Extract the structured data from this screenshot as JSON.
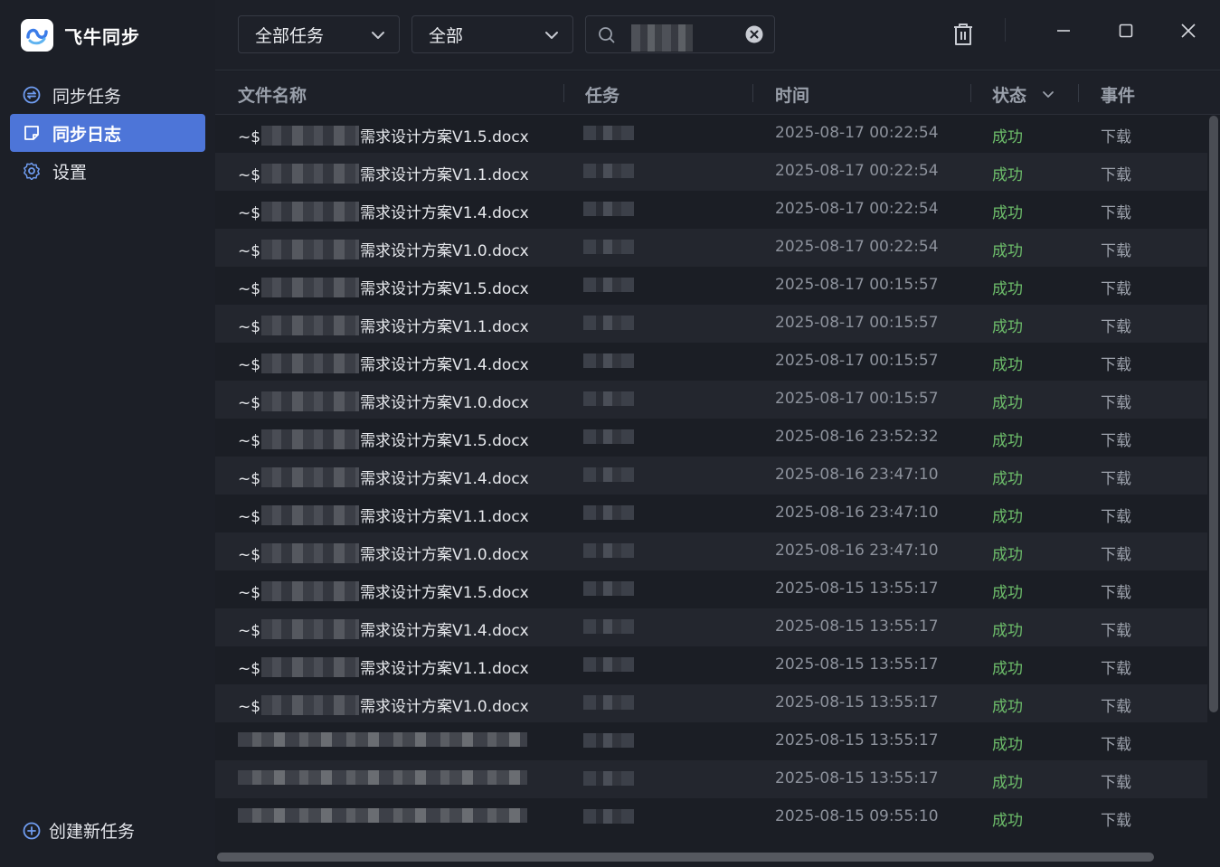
{
  "app": {
    "name": "飞牛同步"
  },
  "sidebar": {
    "items": [
      {
        "label": "同步任务",
        "icon": "sync-icon",
        "active": false
      },
      {
        "label": "同步日志",
        "icon": "log-icon",
        "active": true
      },
      {
        "label": "设置",
        "icon": "gear-icon",
        "active": false
      }
    ],
    "create_label": "创建新任务"
  },
  "toolbar": {
    "task_filter": "全部任务",
    "status_filter": "全部",
    "search_value": ""
  },
  "table": {
    "headers": {
      "file": "文件名称",
      "task": "任务",
      "time": "时间",
      "status": "状态",
      "event": "事件"
    },
    "rows": [
      {
        "prefix": "~$",
        "file": "需求设计方案V1.5.docx",
        "time": "2025-08-17 00:22:54",
        "status": "成功",
        "event": "下载"
      },
      {
        "prefix": "~$",
        "file": "需求设计方案V1.1.docx",
        "time": "2025-08-17 00:22:54",
        "status": "成功",
        "event": "下载"
      },
      {
        "prefix": "~$",
        "file": "需求设计方案V1.4.docx",
        "time": "2025-08-17 00:22:54",
        "status": "成功",
        "event": "下载"
      },
      {
        "prefix": "~$",
        "file": "需求设计方案V1.0.docx",
        "time": "2025-08-17 00:22:54",
        "status": "成功",
        "event": "下载"
      },
      {
        "prefix": "~$",
        "file": "需求设计方案V1.5.docx",
        "time": "2025-08-17 00:15:57",
        "status": "成功",
        "event": "下载"
      },
      {
        "prefix": "~$",
        "file": "需求设计方案V1.1.docx",
        "time": "2025-08-17 00:15:57",
        "status": "成功",
        "event": "下载"
      },
      {
        "prefix": "~$",
        "file": "需求设计方案V1.4.docx",
        "time": "2025-08-17 00:15:57",
        "status": "成功",
        "event": "下载"
      },
      {
        "prefix": "~$",
        "file": "需求设计方案V1.0.docx",
        "time": "2025-08-17 00:15:57",
        "status": "成功",
        "event": "下载"
      },
      {
        "prefix": "~$",
        "file": "需求设计方案V1.5.docx",
        "time": "2025-08-16 23:52:32",
        "status": "成功",
        "event": "下载"
      },
      {
        "prefix": "~$",
        "file": "需求设计方案V1.4.docx",
        "time": "2025-08-16 23:47:10",
        "status": "成功",
        "event": "下载"
      },
      {
        "prefix": "~$",
        "file": "需求设计方案V1.1.docx",
        "time": "2025-08-16 23:47:10",
        "status": "成功",
        "event": "下载"
      },
      {
        "prefix": "~$",
        "file": "需求设计方案V1.0.docx",
        "time": "2025-08-16 23:47:10",
        "status": "成功",
        "event": "下载"
      },
      {
        "prefix": "~$",
        "file": "需求设计方案V1.5.docx",
        "time": "2025-08-15 13:55:17",
        "status": "成功",
        "event": "下载"
      },
      {
        "prefix": "~$",
        "file": "需求设计方案V1.4.docx",
        "time": "2025-08-15 13:55:17",
        "status": "成功",
        "event": "下载"
      },
      {
        "prefix": "~$",
        "file": "需求设计方案V1.1.docx",
        "time": "2025-08-15 13:55:17",
        "status": "成功",
        "event": "下载"
      },
      {
        "prefix": "~$",
        "file": "需求设计方案V1.0.docx",
        "time": "2025-08-15 13:55:17",
        "status": "成功",
        "event": "下载"
      },
      {
        "prefix": "",
        "file": "",
        "time": "2025-08-15 13:55:17",
        "status": "成功",
        "event": "下载"
      },
      {
        "prefix": "",
        "file": "",
        "time": "2025-08-15 13:55:17",
        "status": "成功",
        "event": "下载"
      },
      {
        "prefix": "",
        "file": "",
        "time": "2025-08-15 09:55:10",
        "status": "成功",
        "event": "下载"
      }
    ]
  },
  "colors": {
    "accent": "#4d75d8",
    "success": "#6dbd6a"
  }
}
